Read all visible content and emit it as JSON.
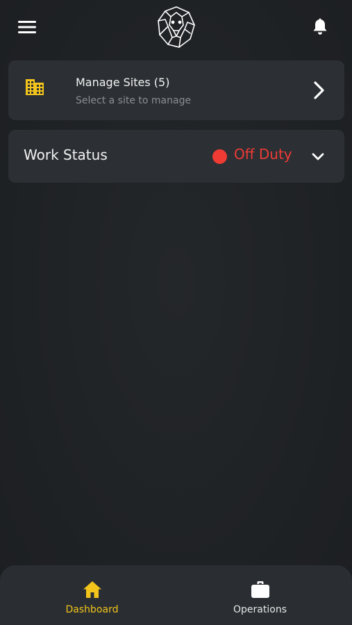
{
  "sites": {
    "title": "Manage Sites (5)",
    "subtitle": "Select a site to manage",
    "icon": "building-icon"
  },
  "work_status": {
    "label": "Work Status",
    "value": "Off Duty",
    "status_color": "#f03b34"
  },
  "bottom_nav": {
    "items": [
      {
        "label": "Dashboard",
        "icon": "home-icon",
        "active": true
      },
      {
        "label": "Operations",
        "icon": "briefcase-icon",
        "active": false
      }
    ]
  },
  "colors": {
    "accent": "#f3c41b",
    "background": "#1f2225",
    "card": "#2c3034",
    "status_off": "#f03b34"
  }
}
